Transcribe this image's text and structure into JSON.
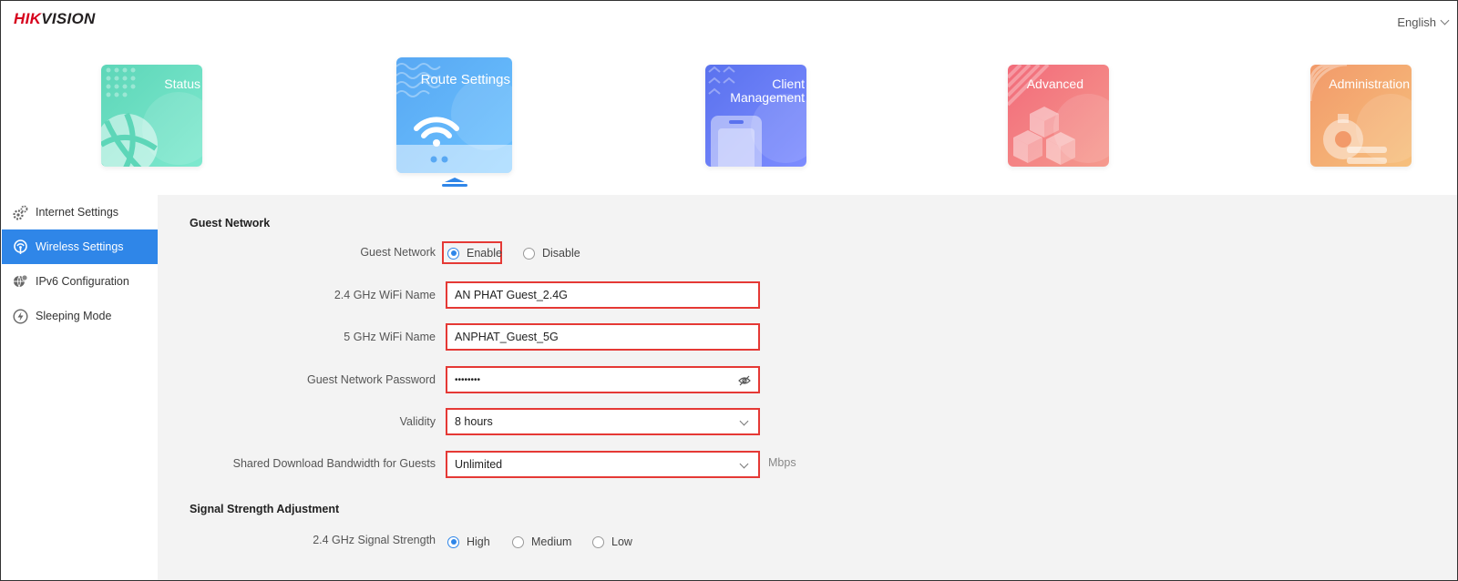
{
  "header": {
    "logo_part1": "HIK",
    "logo_part2": "VISION",
    "language": "English"
  },
  "nav": {
    "status": "Status",
    "route_settings": "Route Settings",
    "client_line1": "Client",
    "client_line2": "Management",
    "advanced": "Advanced",
    "administration": "Administration",
    "active": "route_settings"
  },
  "sidebar": {
    "items": [
      {
        "label": "Internet Settings",
        "icon": "gears-icon"
      },
      {
        "label": "Wireless Settings",
        "icon": "wifi-icon",
        "active": true
      },
      {
        "label": "IPv6 Configuration",
        "icon": "globe-gear-icon"
      },
      {
        "label": "Sleeping Mode",
        "icon": "power-bolt-icon"
      }
    ]
  },
  "guest": {
    "section_title": "Guest Network",
    "network_label": "Guest Network",
    "enable": "Enable",
    "disable": "Disable",
    "enabled": true,
    "wifi24_label": "2.4 GHz WiFi Name",
    "wifi24_value": "AN PHAT Guest_2.4G",
    "wifi5_label": "5 GHz WiFi Name",
    "wifi5_value": "ANPHAT_Guest_5G",
    "password_label": "Guest Network Password",
    "password_value": "••••••••",
    "validity_label": "Validity",
    "validity_value": "8 hours",
    "bandwidth_label": "Shared Download Bandwidth for Guests",
    "bandwidth_value": "Unlimited",
    "bandwidth_unit": "Mbps"
  },
  "signal": {
    "section_title": "Signal Strength Adjustment",
    "label": "2.4 GHz Signal Strength",
    "high": "High",
    "medium": "Medium",
    "low": "Low",
    "selected": "High"
  },
  "colors": {
    "accent": "#2f86e8",
    "highlight": "#e53935",
    "brand_red": "#d6001c"
  }
}
